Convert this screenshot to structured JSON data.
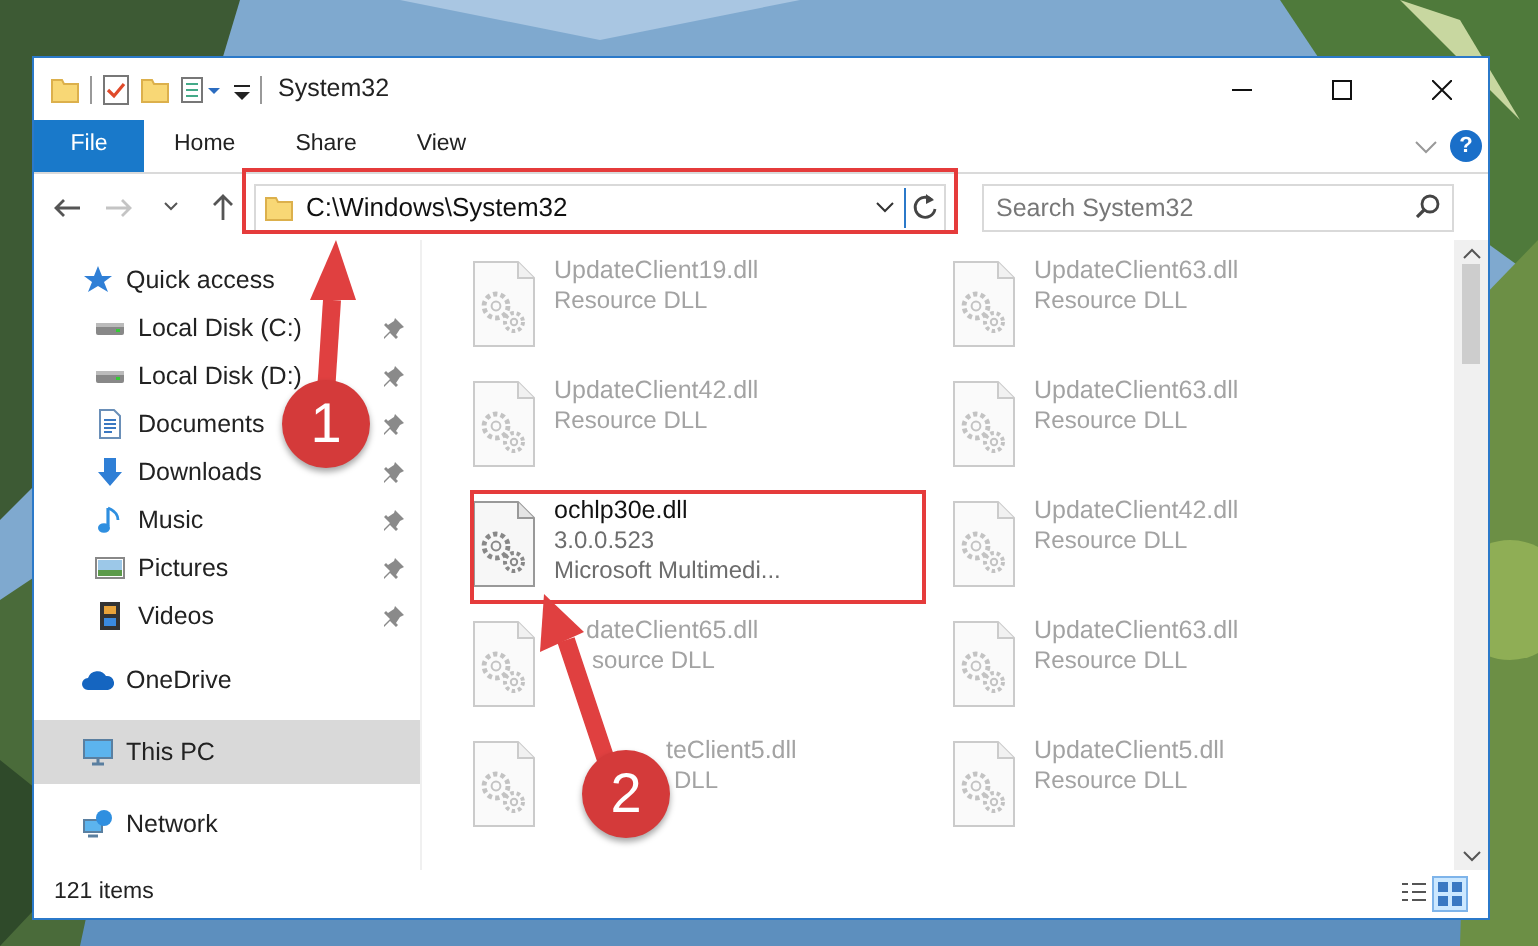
{
  "window": {
    "title": "System32"
  },
  "ribbon": {
    "tabs": [
      {
        "label": "File",
        "kind": "file",
        "selected": false
      },
      {
        "label": "Home",
        "kind": "tab",
        "selected": false
      },
      {
        "label": "Share",
        "kind": "tab",
        "selected": false
      },
      {
        "label": "View",
        "kind": "tab",
        "selected": false
      }
    ],
    "help": "?"
  },
  "navigation": {
    "forward_disabled": true
  },
  "address": {
    "path": "C:\\Windows\\System32"
  },
  "search": {
    "placeholder": "Search System32"
  },
  "sidebar": {
    "items": [
      {
        "label": "Quick access",
        "kind": "star",
        "selected": false,
        "children": [
          {
            "label": "Local Disk (C:)",
            "kind": "drive",
            "pinned": true,
            "selected": false
          },
          {
            "label": "Local Disk (D:)",
            "kind": "drive",
            "pinned": true,
            "selected": false
          },
          {
            "label": "Documents",
            "kind": "document",
            "pinned": true,
            "selected": false
          },
          {
            "label": "Downloads",
            "kind": "download",
            "pinned": true,
            "selected": false
          },
          {
            "label": "Music",
            "kind": "music",
            "pinned": true,
            "selected": false
          },
          {
            "label": "Pictures",
            "kind": "pictures",
            "pinned": true,
            "selected": false
          },
          {
            "label": "Videos",
            "kind": "videos",
            "pinned": true,
            "selected": false
          }
        ]
      },
      {
        "label": "OneDrive",
        "kind": "cloud",
        "selected": false
      },
      {
        "label": "This PC",
        "kind": "pc",
        "selected": true
      },
      {
        "label": "Network",
        "kind": "network",
        "selected": false
      }
    ]
  },
  "files": [
    {
      "name": "UpdateClient19.dll",
      "lines": [
        "Resource DLL"
      ],
      "blurred": true
    },
    {
      "name": "UpdateClient63.dll",
      "lines": [
        "Resource DLL"
      ],
      "blurred": true
    },
    {
      "name": "UpdateClient42.dll",
      "lines": [
        "Resource DLL"
      ],
      "blurred": true
    },
    {
      "name": "UpdateClient63.dll",
      "lines": [
        "Resource DLL"
      ],
      "blurred": true
    },
    {
      "name": "ochlp30e.dll",
      "lines": [
        "3.0.0.523",
        "Microsoft Multimedi..."
      ],
      "blurred": false
    },
    {
      "name": "UpdateClient42.dll",
      "lines": [
        "Resource DLL"
      ],
      "blurred": true
    },
    {
      "name": "dateClient65.dll",
      "lines": [
        "source DLL"
      ],
      "blurred": true
    },
    {
      "name": "UpdateClient63.dll",
      "lines": [
        "Resource DLL"
      ],
      "blurred": true
    },
    {
      "name": "teClient5.dll",
      "lines": [
        "DLL"
      ],
      "blurred": true
    },
    {
      "name": "UpdateClient5.dll",
      "lines": [
        "Resource DLL"
      ],
      "blurred": true
    }
  ],
  "status_bar": {
    "count": "121 items",
    "views": [
      {
        "kind": "details",
        "selected": false
      },
      {
        "kind": "tiles",
        "selected": true
      }
    ]
  },
  "annotations": [
    {
      "label": "1"
    },
    {
      "label": "2"
    }
  ]
}
